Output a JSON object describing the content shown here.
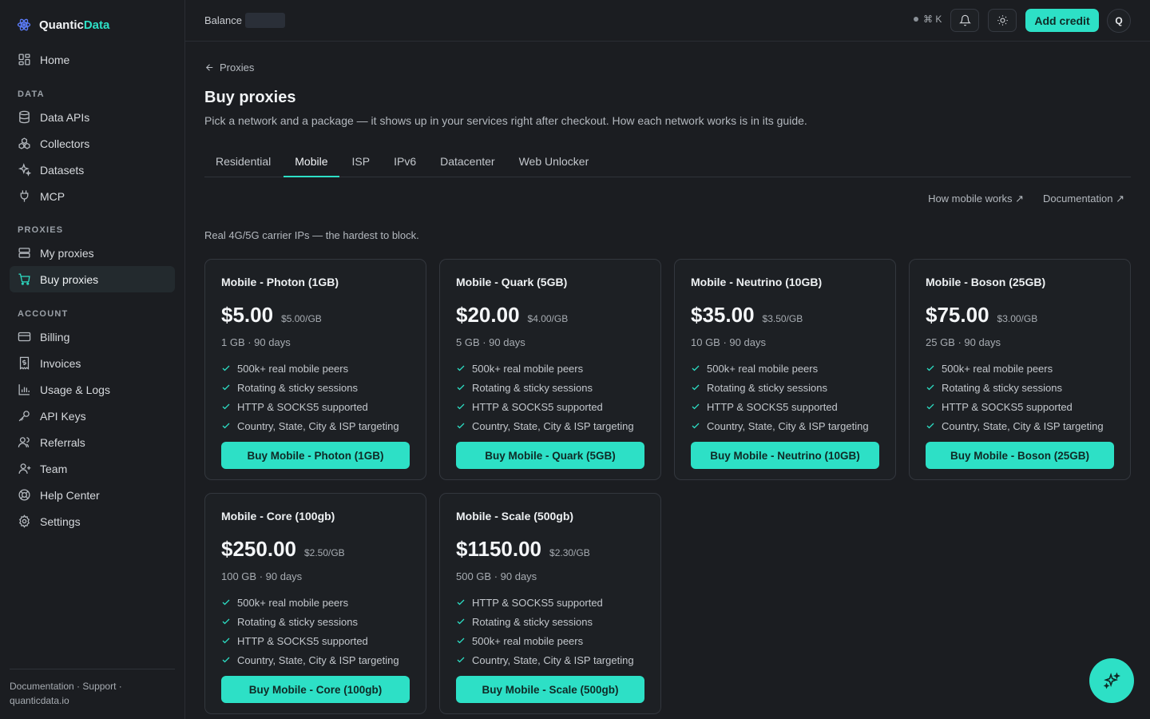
{
  "brand": {
    "name_a": "Quantic",
    "name_b": "Data"
  },
  "sidebar": {
    "home": "Home",
    "sections": {
      "data": "DATA",
      "proxies": "PROXIES",
      "account": "ACCOUNT"
    },
    "data_items": [
      "Data APIs",
      "Collectors",
      "Datasets",
      "MCP"
    ],
    "proxy_items": [
      "My proxies",
      "Buy proxies"
    ],
    "account_items": [
      "Billing",
      "Invoices",
      "Usage & Logs",
      "API Keys",
      "Referrals",
      "Team",
      "Help Center",
      "Settings"
    ],
    "footer": {
      "documentation": "Documentation",
      "sep1": " · ",
      "support": "Support",
      "sep2": " ·",
      "domain": "quanticdata.io"
    }
  },
  "topbar": {
    "balance_label": "Balance",
    "shortcut": "⌘ K",
    "add_credit": "Add credit",
    "avatar_initial": "Q"
  },
  "main": {
    "breadcrumb": "Proxies",
    "title": "Buy proxies",
    "subtitle": "Pick a network and a package — it shows up in your services right after checkout. How each network works is in its guide.",
    "tabs": [
      "Residential",
      "Mobile",
      "ISP",
      "IPv6",
      "Datacenter",
      "Web Unlocker"
    ],
    "active_tab": "Mobile",
    "links": {
      "how_works": "How mobile works ↗",
      "documentation": "Documentation ↗"
    },
    "tagline": "Real 4G/5G carrier IPs — the hardest to block."
  },
  "plans": [
    {
      "name": "Mobile - Photon (1GB)",
      "price": "$5.00",
      "per_gb": "$5.00/GB",
      "meta": "1 GB · 90 days",
      "features": [
        "500k+ real mobile peers",
        "Rotating & sticky sessions",
        "HTTP & SOCKS5 supported",
        "Country, State, City & ISP targeting"
      ],
      "button": "Buy Mobile - Photon (1GB)"
    },
    {
      "name": "Mobile - Quark (5GB)",
      "price": "$20.00",
      "per_gb": "$4.00/GB",
      "meta": "5 GB · 90 days",
      "features": [
        "500k+ real mobile peers",
        "Rotating & sticky sessions",
        "HTTP & SOCKS5 supported",
        "Country, State, City & ISP targeting"
      ],
      "button": "Buy Mobile - Quark (5GB)"
    },
    {
      "name": "Mobile - Neutrino (10GB)",
      "price": "$35.00",
      "per_gb": "$3.50/GB",
      "meta": "10 GB · 90 days",
      "features": [
        "500k+ real mobile peers",
        "Rotating & sticky sessions",
        "HTTP & SOCKS5 supported",
        "Country, State, City & ISP targeting"
      ],
      "button": "Buy Mobile - Neutrino (10GB)"
    },
    {
      "name": "Mobile - Boson (25GB)",
      "price": "$75.00",
      "per_gb": "$3.00/GB",
      "meta": "25 GB · 90 days",
      "features": [
        "500k+ real mobile peers",
        "Rotating & sticky sessions",
        "HTTP & SOCKS5 supported",
        "Country, State, City & ISP targeting"
      ],
      "button": "Buy Mobile - Boson (25GB)"
    },
    {
      "name": "Mobile - Core (100gb)",
      "price": "$250.00",
      "per_gb": "$2.50/GB",
      "meta": "100 GB · 90 days",
      "features": [
        "500k+ real mobile peers",
        "Rotating & sticky sessions",
        "HTTP & SOCKS5 supported",
        "Country, State, City & ISP targeting"
      ],
      "button": "Buy Mobile - Core (100gb)"
    },
    {
      "name": "Mobile - Scale (500gb)",
      "price": "$1150.00",
      "per_gb": "$2.30/GB",
      "meta": "500 GB · 90 days",
      "features": [
        "HTTP & SOCKS5 supported",
        "Rotating & sticky sessions",
        "500k+ real mobile peers",
        "Country, State, City & ISP targeting"
      ],
      "button": "Buy Mobile - Scale (500gb)"
    }
  ],
  "colors": {
    "accent": "#2de0c6",
    "background": "#1b1d21",
    "card": "#1d2024",
    "border": "#33373e"
  },
  "icons": {
    "fab": "sparkles-icon"
  }
}
